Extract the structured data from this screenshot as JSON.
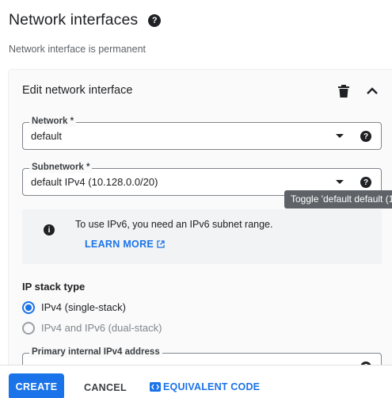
{
  "header": {
    "title": "Network interfaces",
    "subtitle": "Network interface is permanent"
  },
  "panel": {
    "title": "Edit network interface",
    "network": {
      "label": "Network *",
      "value": "default"
    },
    "subnetwork": {
      "label": "Subnetwork *",
      "value": "default IPv4 (10.128.0.0/20)"
    },
    "tooltip": "Toggle 'default default (1",
    "info": {
      "text": "To use IPv6, you need an IPv6 subnet range.",
      "link": "LEARN MORE"
    },
    "ip_stack": {
      "title": "IP stack type",
      "options": [
        {
          "label": "IPv4 (single-stack)",
          "selected": true
        },
        {
          "label": "IPv4 and IPv6 (dual-stack)",
          "selected": false
        }
      ]
    },
    "primary_ip": {
      "label": "Primary internal IPv4 address"
    }
  },
  "footer": {
    "create": "CREATE",
    "cancel": "CANCEL",
    "equivalent": "EQUIVALENT CODE"
  },
  "colors": {
    "accent": "#1a73e8",
    "text": "#202124",
    "muted": "#5f6368"
  },
  "icons": [
    "help-icon",
    "trash-icon",
    "chevron-up-icon",
    "dropdown-caret-icon",
    "info-icon",
    "external-link-icon",
    "code-icon"
  ]
}
